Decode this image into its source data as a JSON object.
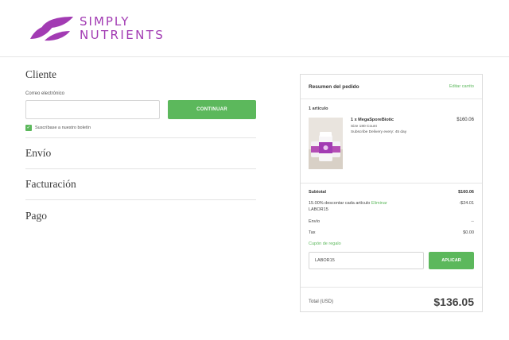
{
  "header": {
    "logo_line1": "SIMPLY",
    "logo_line2": "NUTRIENTS",
    "logo_icon": "leaf-logo-icon"
  },
  "checkout": {
    "customer_title": "Cliente",
    "email_label": "Correo electrónico",
    "email_value": "",
    "continue_label": "CONTINUAR",
    "subscribe_label": "Suscríbase a nuestro boletín",
    "subscribe_checked": true,
    "shipping_title": "Envío",
    "billing_title": "Facturación",
    "payment_title": "Pago"
  },
  "summary": {
    "title": "Resumen del pedido",
    "edit_label": "Editar carrito",
    "items_count": "1 artículo",
    "item": {
      "name": "1 x MegaSporeBiotic",
      "size": "Size 180 Count",
      "delivery": "Subscribe Delivery every: 45 day",
      "price": "$160.06"
    },
    "subtotal_label": "Subtotal",
    "subtotal_value": "$160.06",
    "discount_text": "15.00% descontar cada artículo",
    "discount_remove": "Eliminar",
    "discount_code": "LABOR15",
    "discount_value": "-$24.01",
    "shipping_label": "Envío",
    "shipping_value": "--",
    "tax_label": "Tax",
    "tax_value": "$0.00",
    "coupon_label": "Cupón de regalo",
    "coupon_value": "LABOR15",
    "apply_label": "APLICAR",
    "total_label": "Total (USD)",
    "total_value": "$136.05"
  },
  "colors": {
    "brand": "#a23bb3",
    "accent_green": "#5cb85c"
  }
}
